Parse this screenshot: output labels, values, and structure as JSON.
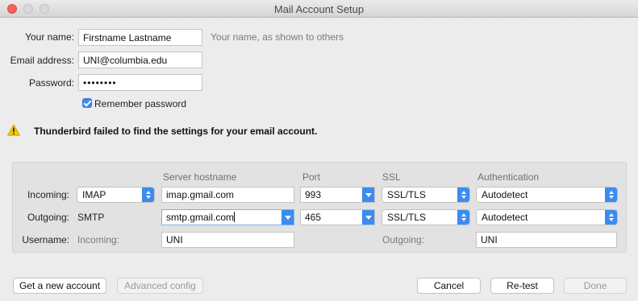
{
  "window": {
    "title": "Mail Account Setup"
  },
  "form": {
    "name_label": "Your name:",
    "name_value": "Firstname Lastname",
    "name_hint": "Your name, as shown to others",
    "email_label": "Email address:",
    "email_value": "UNI@columbia.edu",
    "password_label": "Password:",
    "password_value": "••••••••",
    "remember_label": "Remember password",
    "remember_checked": true
  },
  "warning": {
    "icon": "warning-triangle-icon",
    "text": "Thunderbird failed to find the settings for your email account."
  },
  "server_table": {
    "headers": {
      "hostname": "Server hostname",
      "port": "Port",
      "ssl": "SSL",
      "auth": "Authentication"
    },
    "incoming": {
      "label": "Incoming:",
      "protocol": "IMAP",
      "hostname": "imap.gmail.com",
      "port": "993",
      "ssl": "SSL/TLS",
      "auth": "Autodetect"
    },
    "outgoing": {
      "label": "Outgoing:",
      "protocol": "SMTP",
      "hostname": "smtp.gmail.com",
      "port": "465",
      "ssl": "SSL/TLS",
      "auth": "Autodetect"
    },
    "username": {
      "label": "Username:",
      "incoming_label": "Incoming:",
      "incoming_value": "UNI",
      "outgoing_label": "Outgoing:",
      "outgoing_value": "UNI"
    }
  },
  "buttons": {
    "new_account": "Get a new account",
    "advanced": "Advanced config",
    "cancel": "Cancel",
    "retest": "Re-test",
    "done": "Done"
  },
  "colors": {
    "accent": "#3b8bf0",
    "warning": "#f5c400",
    "close_button": "#fc605c"
  }
}
